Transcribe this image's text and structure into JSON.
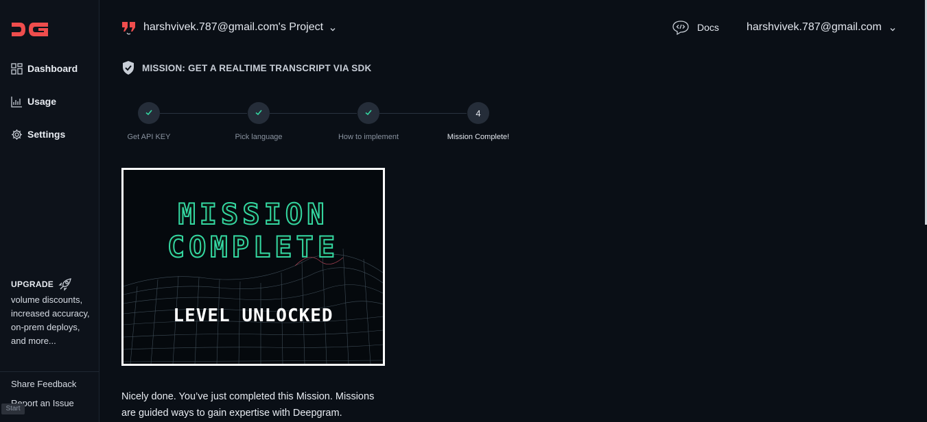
{
  "brand": {
    "logo_text": "DG",
    "accent": "#ef4d4d"
  },
  "sidebar": {
    "items": [
      {
        "label": "Dashboard",
        "icon": "dashboard-icon"
      },
      {
        "label": "Usage",
        "icon": "chart-icon"
      },
      {
        "label": "Settings",
        "icon": "gear-icon"
      }
    ],
    "upgrade": {
      "title": "UPGRADE",
      "icon": "rocket-icon",
      "text": "volume discounts, increased accuracy, on-prem deploys, and more..."
    },
    "links": {
      "feedback": "Share Feedback",
      "report": "Report an Issue"
    },
    "status_chip": "Start"
  },
  "header": {
    "project": "harshvivek.787@gmail.com's Project",
    "docs": "Docs",
    "user": "harshvivek.787@gmail.com"
  },
  "mission": {
    "title": "MISSION: GET A REALTIME TRANSCRIPT VIA SDK",
    "steps": [
      {
        "label": "Get API KEY",
        "marker": "✓",
        "status": "done"
      },
      {
        "label": "Pick language",
        "marker": "✓",
        "status": "done"
      },
      {
        "label": "How to implement",
        "marker": "✓",
        "status": "done"
      },
      {
        "label": "Mission Complete!",
        "marker": "4",
        "status": "current"
      }
    ],
    "image": {
      "line1": "MISSION",
      "line2": "COMPLETE",
      "line3": "LEVEL UNLOCKED",
      "accent": "#34d8a2"
    },
    "message": "Nicely done. You’ve just completed this Mission. Missions are guided ways to gain expertise with Deepgram."
  }
}
